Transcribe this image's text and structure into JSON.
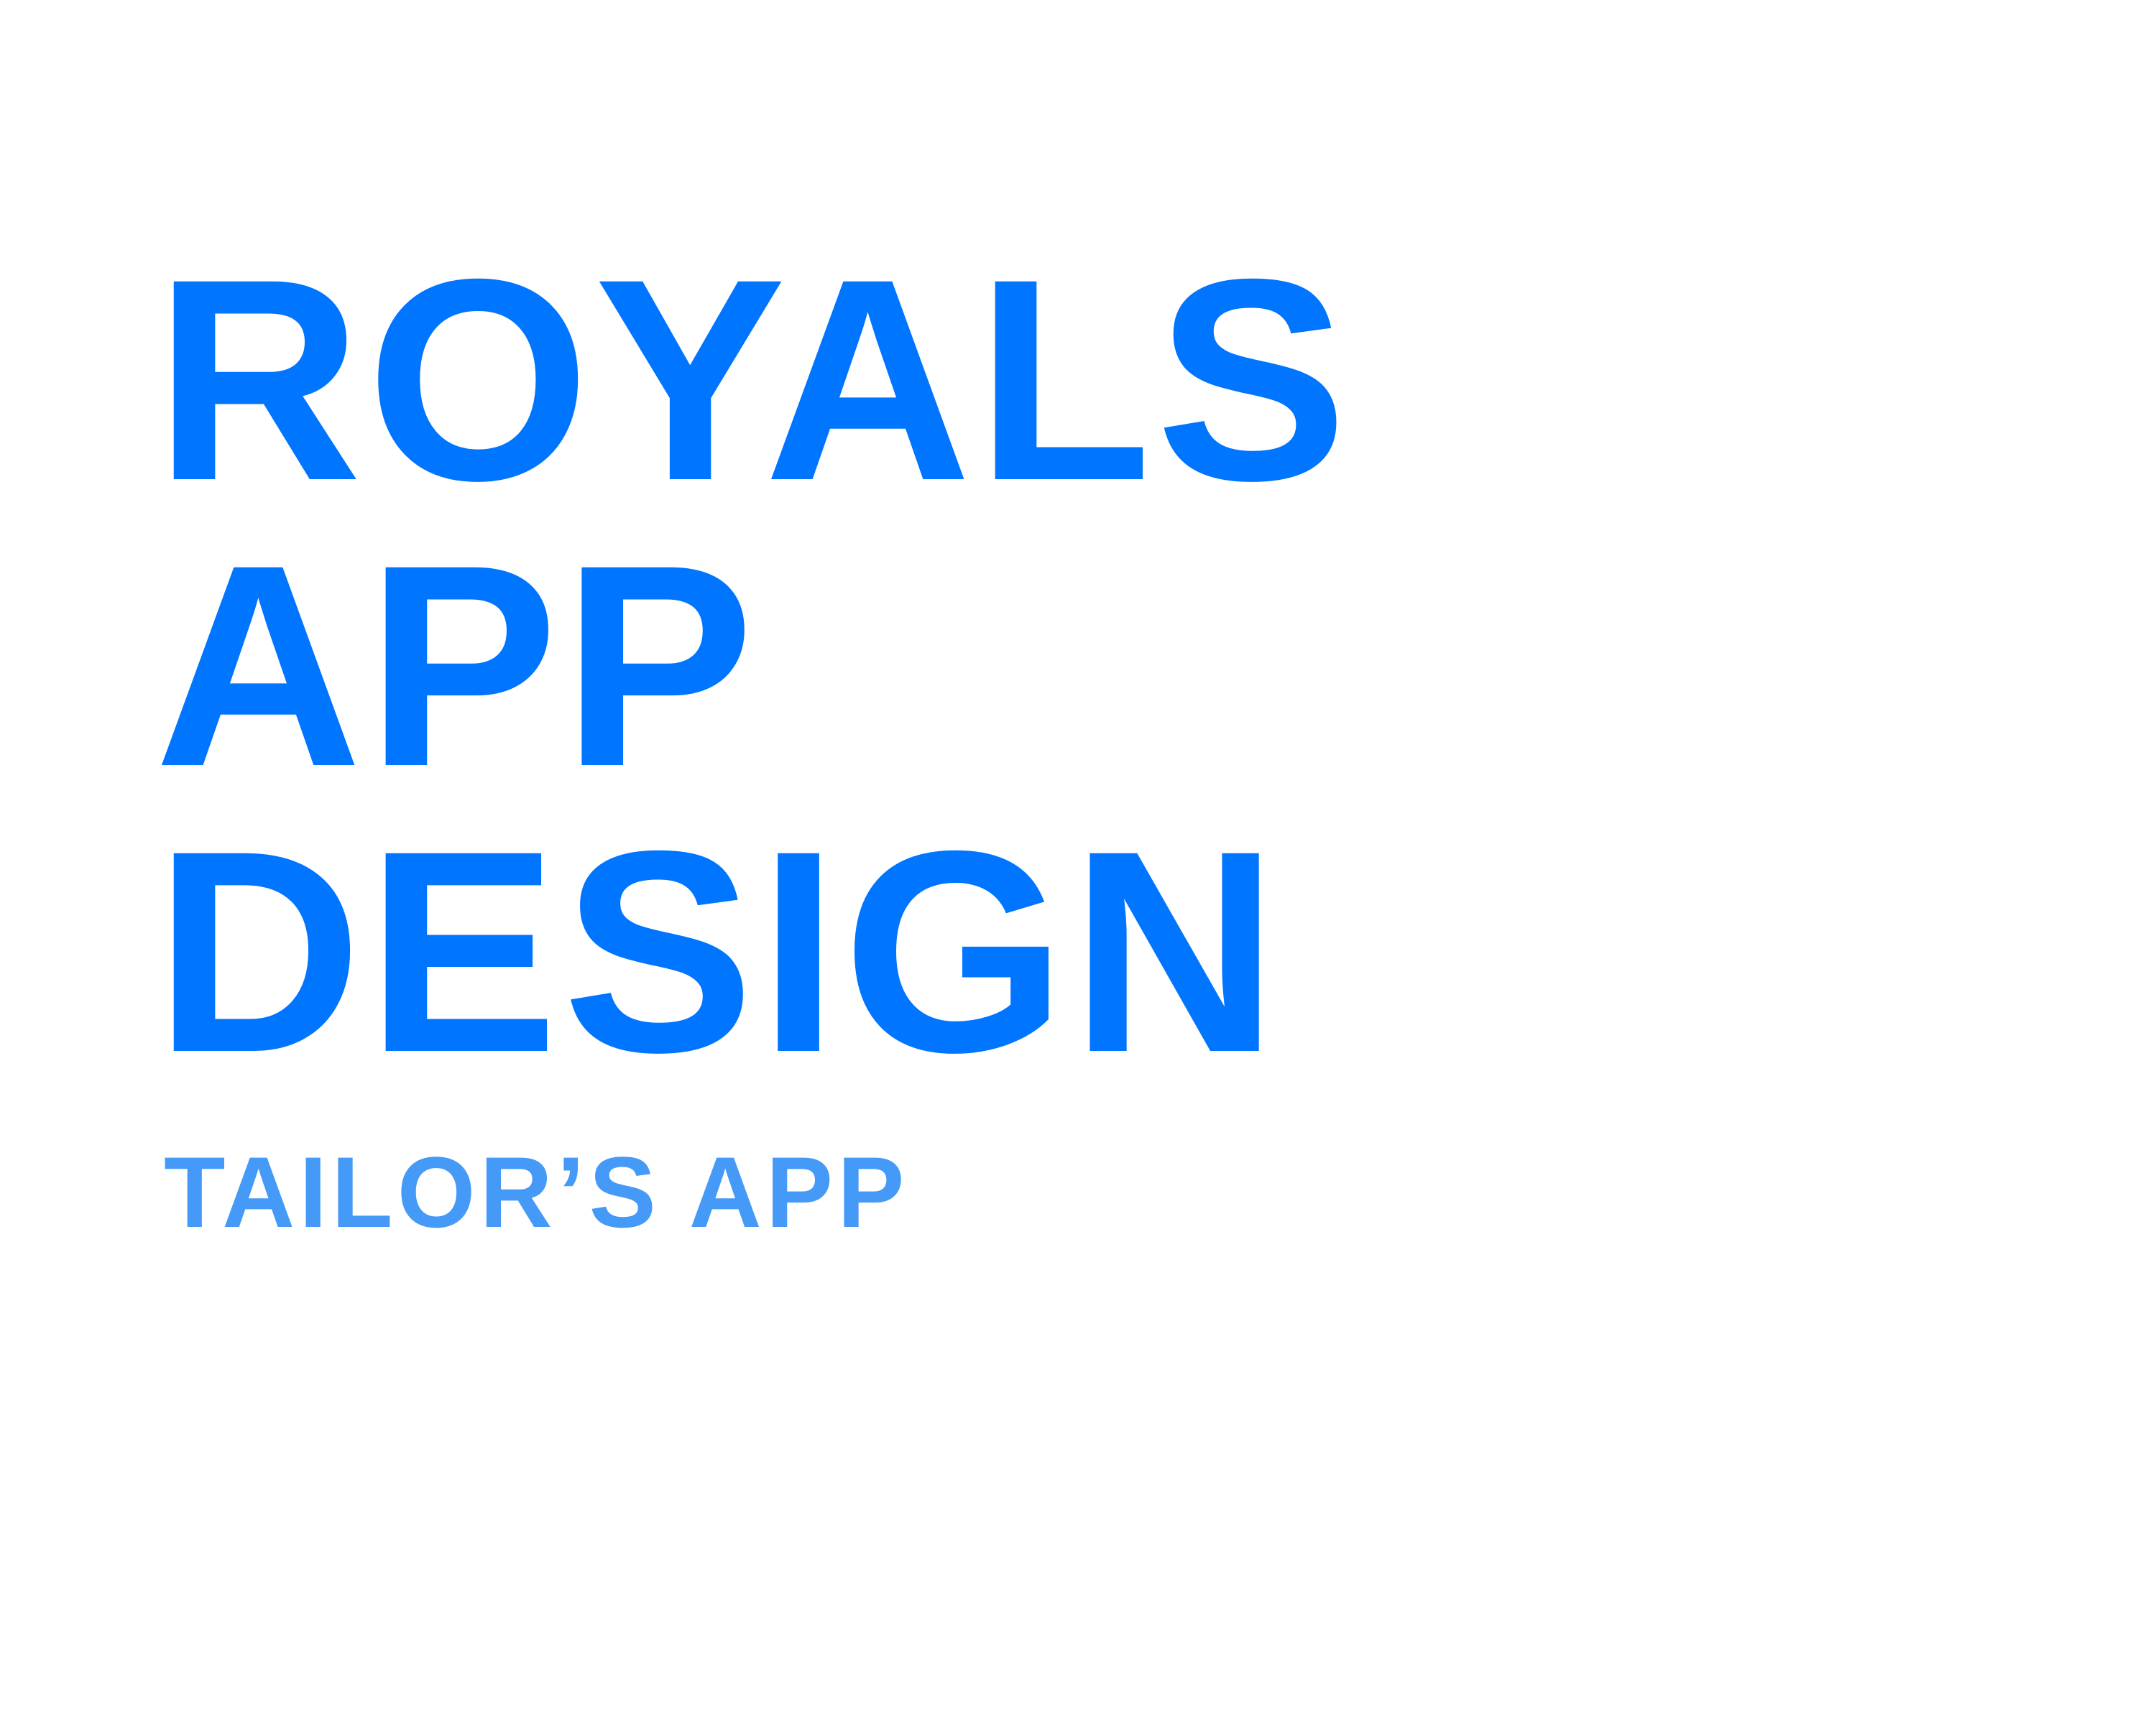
{
  "title": {
    "lines": [
      "ROYALS",
      "APP",
      "DESIGN"
    ]
  },
  "subtitle": "TAILOR’S APP",
  "colors": {
    "title": "#0075FF",
    "subtitle": "#4599F7",
    "background": "#FFFFFF"
  }
}
